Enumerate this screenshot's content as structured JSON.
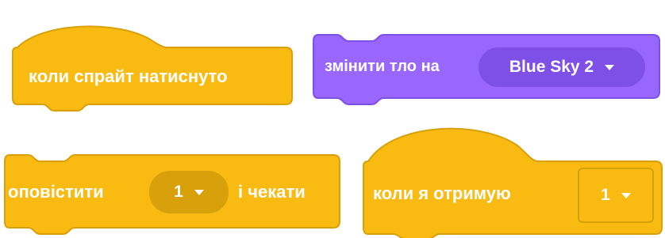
{
  "colors": {
    "events": "#f9ba11",
    "events_dark": "#d8a00a",
    "looks": "#9966ff",
    "looks_dark": "#7e50e8"
  },
  "blocks": {
    "when_sprite_clicked": {
      "label": "коли спрайт натиснуто"
    },
    "switch_backdrop": {
      "label": "змінити тло на",
      "menu_value": "Blue Sky 2"
    },
    "broadcast_and_wait": {
      "label_before": "оповістити",
      "menu_value": "1",
      "label_after": "і чекати"
    },
    "when_i_receive": {
      "label": "коли я отримую",
      "menu_value": "1"
    }
  }
}
